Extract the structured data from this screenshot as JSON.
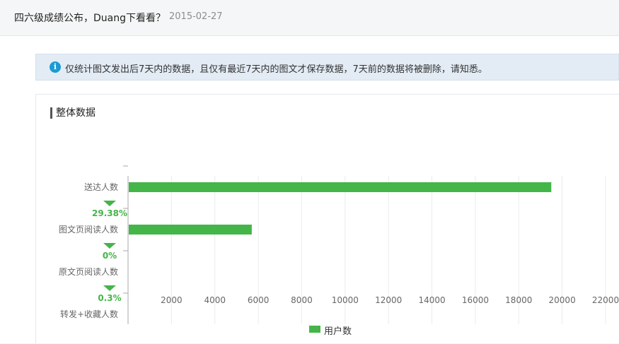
{
  "header": {
    "title": "四六级成绩公布，Duang下看看？",
    "date": "2015-02-27"
  },
  "notice": {
    "icon": "info-icon",
    "text": "仅统计图文发出后7天内的数据，且仅有最近7天内的图文才保存数据，7天前的数据将被删除，请知悉。"
  },
  "section": {
    "title": "整体数据"
  },
  "chart_data": {
    "type": "bar",
    "orientation": "horizontal",
    "title": "",
    "categories": [
      "送达人数",
      "图文页阅读人数",
      "原文页阅读人数",
      "转发+收藏人数"
    ],
    "series": [
      {
        "name": "用户数",
        "color": "#44b549",
        "values": [
          19500,
          5700,
          0,
          0
        ]
      }
    ],
    "conversion_rates": [
      "29.38%",
      "0%",
      "0.3%"
    ],
    "x_ticks": [
      2000,
      4000,
      6000,
      8000,
      10000,
      12000,
      14000,
      16000,
      18000,
      20000,
      22000
    ],
    "xlim": [
      0,
      22000
    ],
    "grid": true,
    "legend_position": "bottom-center"
  },
  "colors": {
    "bar": "#44b549",
    "rate_text": "#44b549",
    "notice_bg": "#e3ecf5",
    "info_icon": "#1a9bd7"
  }
}
